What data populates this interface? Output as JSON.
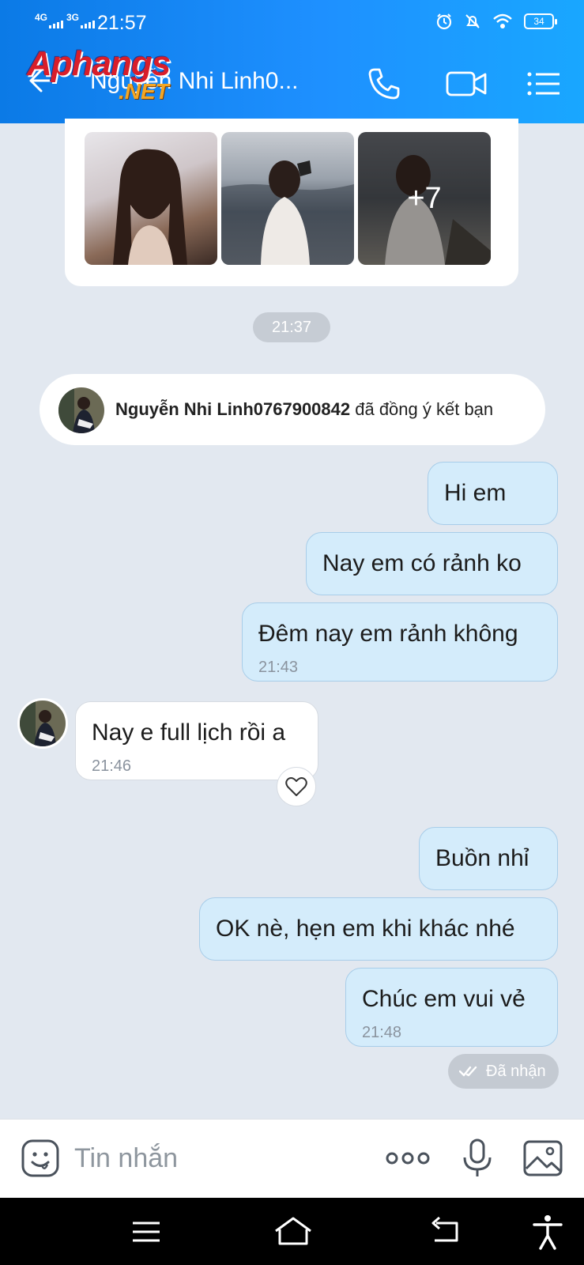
{
  "status_bar": {
    "network1": "4G",
    "network2": "3G",
    "time": "21:57",
    "battery": "34"
  },
  "header": {
    "title": "Nguyễn Nhi Linh0...",
    "watermark_main": "Aphangs",
    "watermark_sub": ".NET"
  },
  "photo_gallery": {
    "more_count": "+7"
  },
  "chat": {
    "time_divider": "21:37",
    "friend_notice": {
      "name": "Nguyễn Nhi Linh0767900842",
      "action": " đã đồng ý kết bạn"
    },
    "messages": [
      {
        "from": "me",
        "text": "Hi em"
      },
      {
        "from": "me",
        "text": "Nay em có rảnh ko"
      },
      {
        "from": "me",
        "text": "Đêm nay em rảnh không",
        "time": "21:43"
      },
      {
        "from": "them",
        "text": "Nay e full lịch rồi a",
        "time": "21:46"
      },
      {
        "from": "me",
        "text": "Buồn nhỉ"
      },
      {
        "from": "me",
        "text": "OK nè,  hẹn em khi khác nhé"
      },
      {
        "from": "me",
        "text": "Chúc em vui vẻ",
        "time": "21:48"
      }
    ],
    "received_status": "Đã nhận"
  },
  "input_bar": {
    "placeholder": "Tin nhắn"
  },
  "colors": {
    "header_accent": "#1e90ff",
    "my_bubble": "#d4ecfb",
    "chat_background": "#e2e8f0"
  }
}
